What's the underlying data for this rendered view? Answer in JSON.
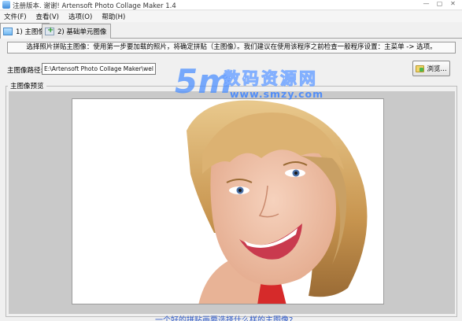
{
  "window": {
    "title": "注册版本. 谢谢! Artensoft Photo Collage Maker 1.4",
    "buttons": {
      "minimize": "—",
      "maximize": "▢",
      "close": "✕"
    }
  },
  "menu": {
    "items": [
      {
        "label": "文件(F)"
      },
      {
        "label": "查看(V)"
      },
      {
        "label": "选项(O)"
      },
      {
        "label": "帮助(H)"
      }
    ]
  },
  "tabs": [
    {
      "label": "1) 主图像",
      "active": true,
      "icon": "main-image-icon"
    },
    {
      "label": "2) 基础单元图像",
      "active": false,
      "icon": "add-image-icon"
    }
  ],
  "main_tab": {
    "instruction": "选择照片拼贴主图像：使用第一步要加载的照片，将确定拼贴（主图像）。我们建议在使用该程序之前检查一般程序设置：主菜单 -> 选项。",
    "path_label": "主图像路径:",
    "path_value": "E:\\Artensoft Photo Collage Maker\\welcome.jpg",
    "browse_label": "浏览...",
    "preview_group_label": "主图像预览",
    "bottom_link": "一个好的拼贴画要选择什么样的主图像?"
  },
  "watermark": {
    "logo_text": "5m",
    "cn_text": "数码资源网",
    "url": "www.smzy.com"
  },
  "colors": {
    "preview_background": "#c9c9c9",
    "link": "#2a56c6",
    "watermark_blue": "#468cff"
  }
}
